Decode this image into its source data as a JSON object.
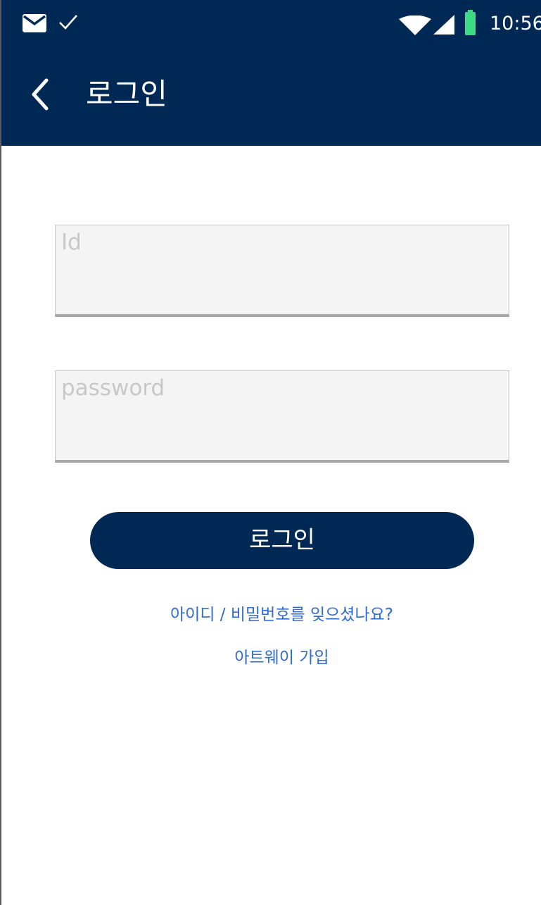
{
  "status_bar": {
    "time": "10:56",
    "icons": [
      "mail-icon",
      "check-icon",
      "wifi-icon",
      "cell-signal-icon",
      "battery-icon"
    ]
  },
  "app_bar": {
    "title": "로그인",
    "back_icon": "chevron-left-icon"
  },
  "form": {
    "id_placeholder": "Id",
    "password_placeholder": "password",
    "login_label": "로그인"
  },
  "links": {
    "forgot": "아이디 / 비밀번호를 잊으셨나요?",
    "signup": "아트웨이 가입"
  },
  "colors": {
    "primary": "#002855",
    "link": "#2f6bd7",
    "battery": "#3ddc84",
    "field_bg": "#f4f4f4"
  }
}
